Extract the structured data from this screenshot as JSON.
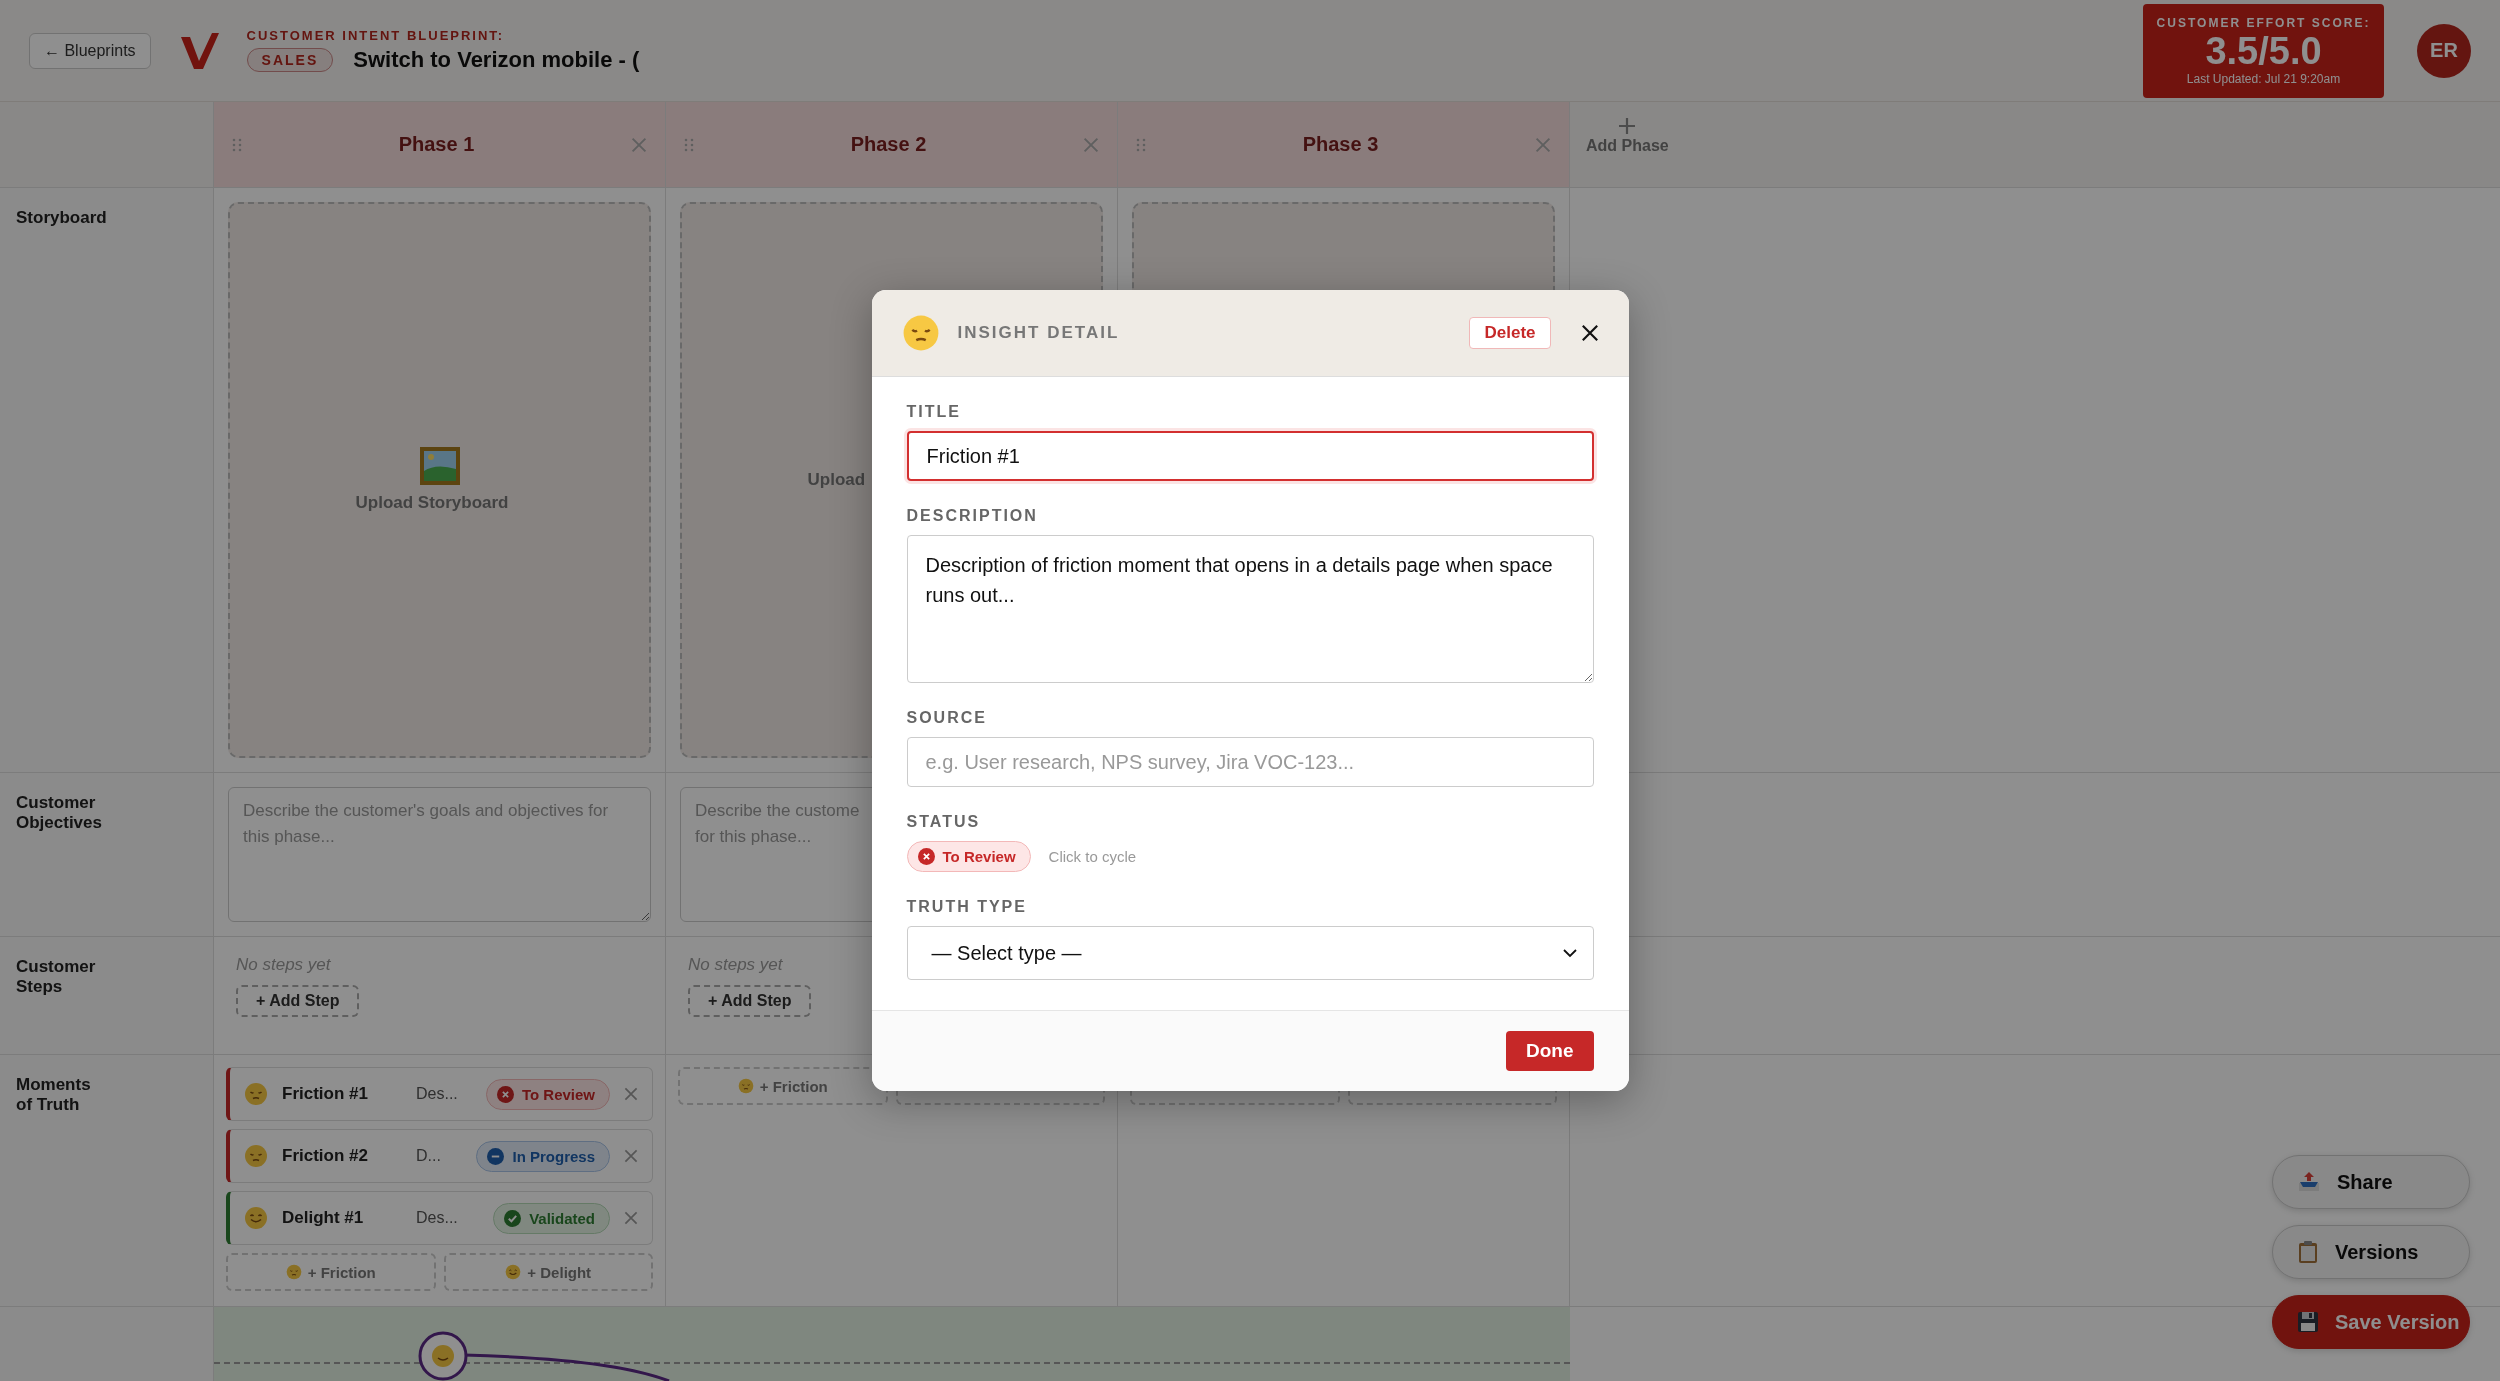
{
  "header": {
    "back_button": "← Blueprints",
    "blueprint_label": "CUSTOMER INTENT BLUEPRINT:",
    "tag": "SALES",
    "title": "Switch to Verizon mobile - (",
    "score": {
      "label": "CUSTOMER EFFORT SCORE:",
      "value": "3.5/5.0",
      "updated": "Last Updated: Jul 21 9:20am"
    },
    "avatar": "ER"
  },
  "add_phase": "Add Phase",
  "row_labels": [
    "Storyboard",
    "Customer Objectives",
    "Customer Steps",
    "Moments of Truth"
  ],
  "phases": [
    {
      "name": "Phase 1",
      "storyboard": {
        "label": "Upload Storyboard",
        "icon": true
      },
      "objectives_placeholder": "Describe the customer's goals and objectives for this phase...",
      "steps_empty": "No steps yet",
      "add_step": "+ Add Step",
      "moments": [
        {
          "title": "Friction #1",
          "kind": "friction",
          "description": "Des...",
          "status": {
            "label": "To Review",
            "kind": "review"
          }
        },
        {
          "title": "Friction #2",
          "kind": "friction",
          "description": "D...",
          "status": {
            "label": "In Progress",
            "kind": "progress"
          }
        },
        {
          "title": "Delight #1",
          "kind": "delight",
          "description": "Des...",
          "status": {
            "label": "Validated",
            "kind": "validated"
          }
        }
      ],
      "add_buttons": [
        {
          "kind": "friction",
          "label": "+ Friction"
        },
        {
          "kind": "delight",
          "label": "+ Delight"
        }
      ]
    },
    {
      "name": "Phase 2",
      "storyboard": {
        "label": "Upload",
        "icon": false
      },
      "objectives_placeholder": "Describe the custome\nfor this phase...",
      "steps_empty": "No steps yet",
      "add_step": "+ Add Step",
      "add_buttons": [
        {
          "kind": "friction",
          "label": "+ Friction"
        },
        {
          "kind": "delight"
        }
      ]
    },
    {
      "name": "Phase 3",
      "add_buttons": [
        {
          "kind": "friction"
        },
        {
          "kind": "delight"
        }
      ]
    }
  ],
  "modal": {
    "title": "INSIGHT DETAIL",
    "kind": "friction",
    "delete": "Delete",
    "title_label": "TITLE",
    "title_value": "Friction #1",
    "description_label": "DESCRIPTION",
    "description_value": "Description of friction moment that opens in a details page when space runs out...",
    "source_label": "SOURCE",
    "source_placeholder": "e.g. User research, NPS survey, Jira VOC-123...",
    "status_label": "STATUS",
    "status": {
      "label": "To Review",
      "kind": "review"
    },
    "status_hint": "Click to cycle",
    "truth_type_label": "TRUTH TYPE",
    "truth_type_value": "— Select type —",
    "done": "Done"
  },
  "actions": [
    {
      "kind": "share",
      "label": "Share"
    },
    {
      "kind": "versions",
      "label": "Versions"
    },
    {
      "kind": "save",
      "label": "Save Version"
    }
  ]
}
